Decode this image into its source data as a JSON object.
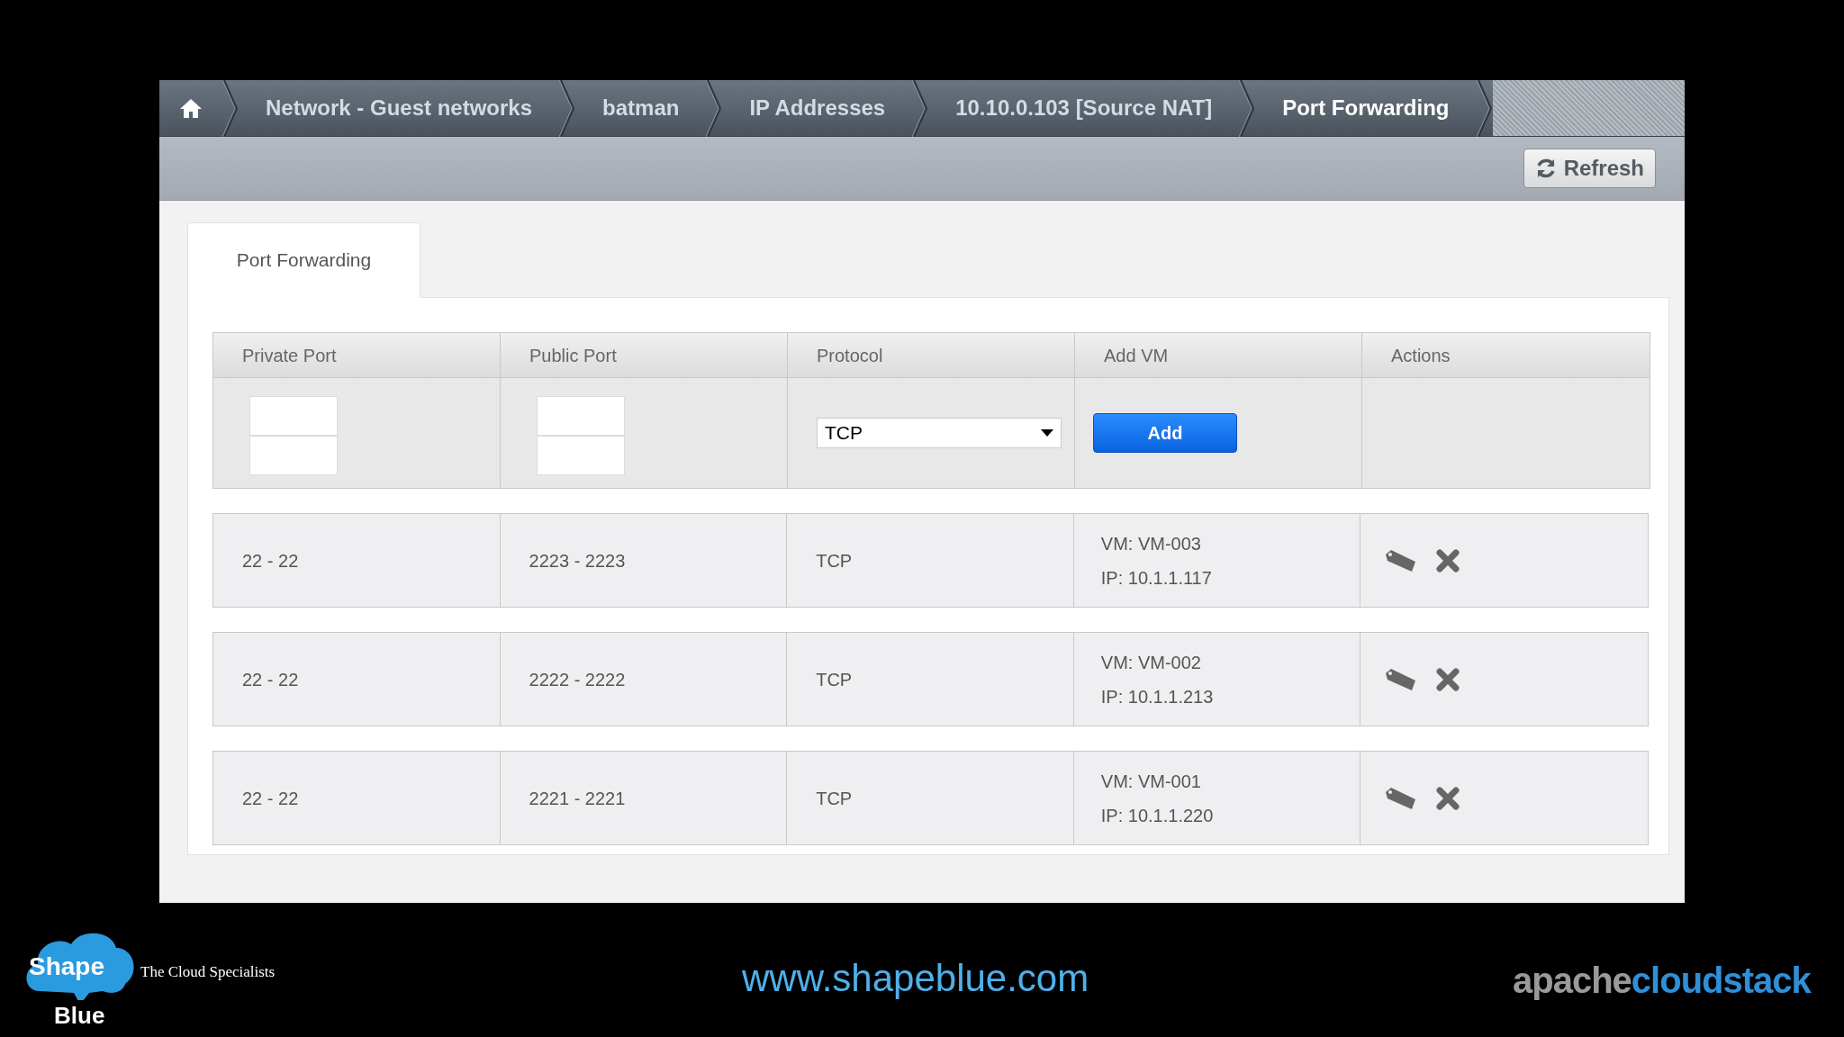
{
  "breadcrumbs": [
    {
      "label": "Network - Guest networks",
      "current": false
    },
    {
      "label": "batman",
      "current": false
    },
    {
      "label": "IP Addresses",
      "current": false
    },
    {
      "label": "10.10.0.103 [Source NAT]",
      "current": false
    },
    {
      "label": "Port Forwarding",
      "current": true
    }
  ],
  "toolbar": {
    "refresh_button": "Refresh"
  },
  "tabs": [
    {
      "label": "Port Forwarding",
      "selected": true
    }
  ],
  "table": {
    "columns": [
      "Private Port",
      "Public Port",
      "Protocol",
      "Add VM",
      "Actions"
    ],
    "new_rule": {
      "protocol": "TCP",
      "add_button": "Add"
    },
    "rows": [
      {
        "private_port": "22 - 22",
        "public_port": "2223 - 2223",
        "protocol": "TCP",
        "vm": "VM: VM-003",
        "ip": "IP: 10.1.1.117"
      },
      {
        "private_port": "22 - 22",
        "public_port": "2222 - 2222",
        "protocol": "TCP",
        "vm": "VM: VM-002",
        "ip": "IP: 10.1.1.213"
      },
      {
        "private_port": "22 - 22",
        "public_port": "2221 - 2221",
        "protocol": "TCP",
        "vm": "VM: VM-001",
        "ip": "IP: 10.1.1.220"
      }
    ]
  },
  "footer": {
    "logo_top": "Shape",
    "logo_bottom": "Blue",
    "tagline": "The Cloud Specialists",
    "url": "www.shapeblue.com",
    "brand_part1": "apache",
    "brand_part2": "cloudstack"
  }
}
